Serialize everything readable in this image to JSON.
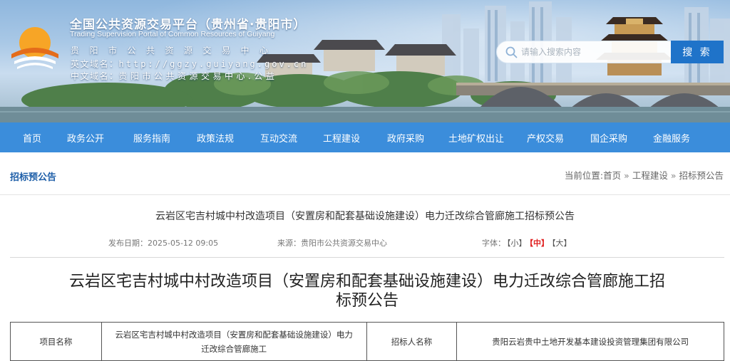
{
  "header": {
    "site_title": "全国公共资源交易平台（贵州省·贵阳市）",
    "site_title_en": "Trading Supervision Portal of Common Resources of Guiyang",
    "org_line": "贵阳市公共资源交易中心",
    "en_domain_label": "英文域名：",
    "en_domain_value": "http://ggzy.guiyang.gov.cn",
    "cn_domain_label": "中文域名：",
    "cn_domain_value": "贵阳市公共资源交易中心.公益"
  },
  "search": {
    "placeholder": "请输入搜索内容",
    "button_label": "搜 索"
  },
  "nav": {
    "items": [
      "首页",
      "政务公开",
      "服务指南",
      "政策法规",
      "互动交流",
      "工程建设",
      "政府采购",
      "土地矿权出让",
      "产权交易",
      "国企采购",
      "金融服务"
    ]
  },
  "section": {
    "title": "招标预公告"
  },
  "breadcrumb": {
    "prefix": "当前位置:",
    "items": [
      "首页",
      "工程建设",
      "招标预公告"
    ],
    "separator": "»"
  },
  "notice": {
    "title": "云岩区宅吉村城中村改造项目（安置房和配套基础设施建设）电力迁改综合管廊施工招标预公告",
    "date_label": "发布日期：",
    "date_value": "2025-05-12 09:05",
    "source_label": "来源：",
    "source_value": "贵阳市公共资源交易中心",
    "font_label": "字体：",
    "font_small": "【小】",
    "font_medium": "【中】",
    "font_large": "【大】"
  },
  "doc": {
    "heading_line1": "云岩区宅吉村城中村改造项目（安置房和配套基础设施建设）电力迁改综合管廊施工招",
    "heading_line2": "标预公告"
  },
  "table": {
    "project_name_label": "项目名称",
    "project_name_line1": "云岩区宅吉村城中村改造项目（安置房和配套基础设施建设）电力",
    "project_name_line2": "迁改综合管廊施工",
    "tenderer_label": "招标人名称",
    "tenderer_value": "贵阳云岩贵中土地开发基本建设投资管理集团有限公司"
  },
  "colors": {
    "nav_bg": "#3b8ddb",
    "search_button": "#1f73c9",
    "section_title": "#1d5ea8",
    "font_active": "#e02020"
  }
}
